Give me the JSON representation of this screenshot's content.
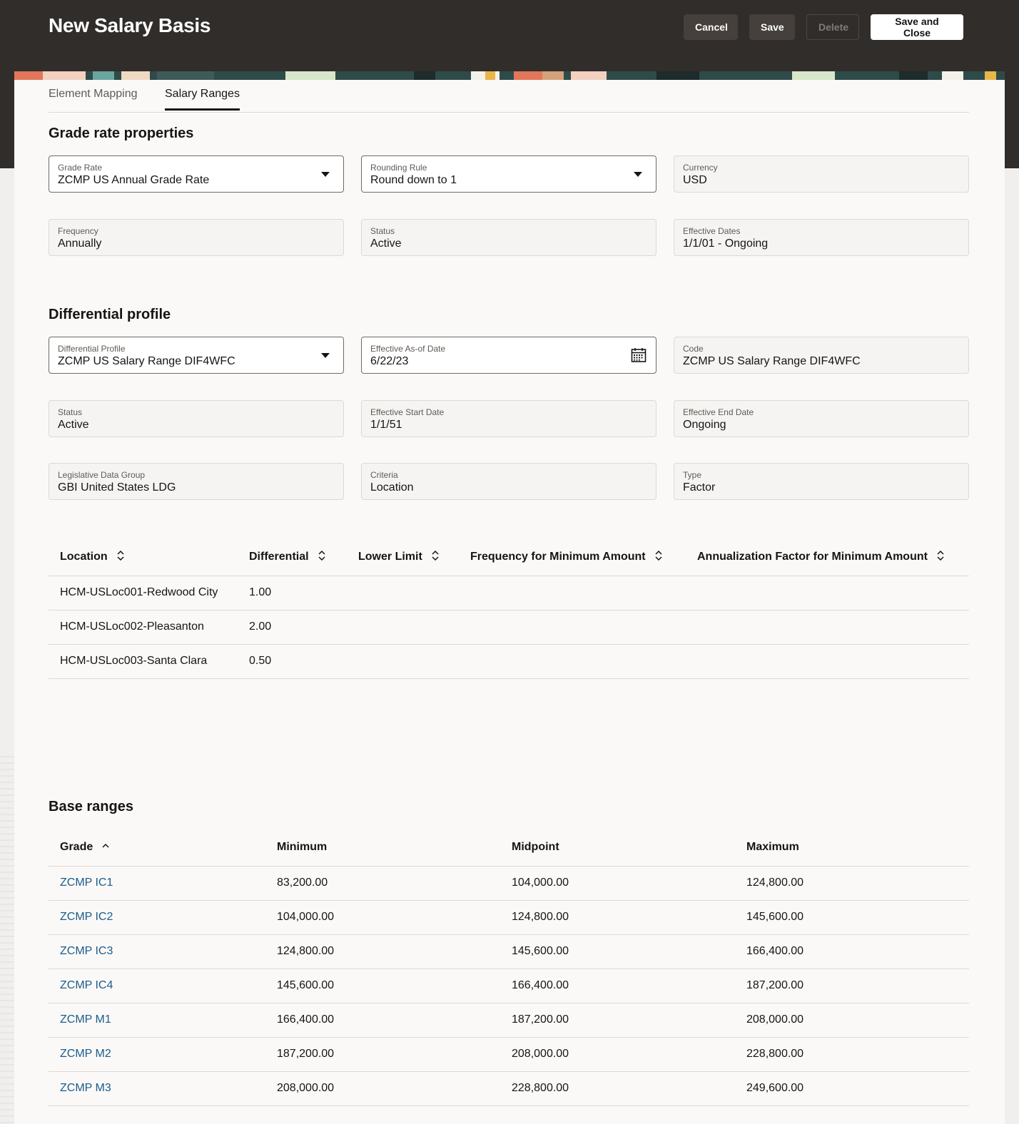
{
  "header": {
    "title": "New Salary Basis",
    "buttons": {
      "cancel": "Cancel",
      "save": "Save",
      "delete": "Delete",
      "save_close": "Save and Close"
    }
  },
  "tabs": [
    {
      "label": "Element Mapping",
      "active": false
    },
    {
      "label": "Salary Ranges",
      "active": true
    }
  ],
  "grade_rate_properties": {
    "title": "Grade rate properties",
    "grade_rate": {
      "label": "Grade Rate",
      "value": "ZCMP US Annual Grade Rate"
    },
    "rounding_rule": {
      "label": "Rounding Rule",
      "value": "Round down to 1"
    },
    "currency": {
      "label": "Currency",
      "value": "USD"
    },
    "frequency": {
      "label": "Frequency",
      "value": "Annually"
    },
    "status": {
      "label": "Status",
      "value": "Active"
    },
    "effective_dates": {
      "label": "Effective Dates",
      "value": "1/1/01 - Ongoing"
    }
  },
  "differential_profile": {
    "title": "Differential profile",
    "profile": {
      "label": "Differential Profile",
      "value": "ZCMP US Salary Range DIF4WFC"
    },
    "as_of_date": {
      "label": "Effective As-of Date",
      "value": "6/22/23"
    },
    "code": {
      "label": "Code",
      "value": "ZCMP US Salary Range DIF4WFC"
    },
    "status": {
      "label": "Status",
      "value": "Active"
    },
    "start_date": {
      "label": "Effective Start Date",
      "value": "1/1/51"
    },
    "end_date": {
      "label": "Effective End Date",
      "value": "Ongoing"
    },
    "ldg": {
      "label": "Legislative Data Group",
      "value": "GBI United States LDG"
    },
    "criteria": {
      "label": "Criteria",
      "value": "Location"
    },
    "type": {
      "label": "Type",
      "value": "Factor"
    },
    "table": {
      "columns": [
        "Location",
        "Differential",
        "Lower Limit",
        "Frequency for Minimum Amount",
        "Annualization Factor for Minimum Amount"
      ],
      "rows": [
        [
          "HCM-USLoc001-Redwood City",
          "1.00",
          "",
          "",
          ""
        ],
        [
          "HCM-USLoc002-Pleasanton",
          "2.00",
          "",
          "",
          ""
        ],
        [
          "HCM-USLoc003-Santa Clara",
          "0.50",
          "",
          "",
          ""
        ]
      ]
    }
  },
  "base_ranges": {
    "title": "Base ranges",
    "columns": [
      "Grade",
      "Minimum",
      "Midpoint",
      "Maximum"
    ],
    "rows": [
      [
        "ZCMP IC1",
        "83,200.00",
        "104,000.00",
        "124,800.00"
      ],
      [
        "ZCMP IC2",
        "104,000.00",
        "124,800.00",
        "145,600.00"
      ],
      [
        "ZCMP IC3",
        "124,800.00",
        "145,600.00",
        "166,400.00"
      ],
      [
        "ZCMP IC4",
        "145,600.00",
        "166,400.00",
        "187,200.00"
      ],
      [
        "ZCMP M1",
        "166,400.00",
        "187,200.00",
        "208,000.00"
      ],
      [
        "ZCMP M2",
        "187,200.00",
        "208,000.00",
        "228,800.00"
      ],
      [
        "ZCMP M3",
        "208,000.00",
        "228,800.00",
        "249,600.00"
      ]
    ]
  },
  "colors": {
    "header_bg": "#312d2a",
    "panel_bg": "#fbf9f8",
    "link": "#1b5c8a",
    "text": "#161513"
  },
  "icons": {
    "dropdown": "caret-down-icon",
    "calendar": "calendar-icon",
    "sort": "sort-icon",
    "sort_ascending": "sort-ascending-icon"
  }
}
